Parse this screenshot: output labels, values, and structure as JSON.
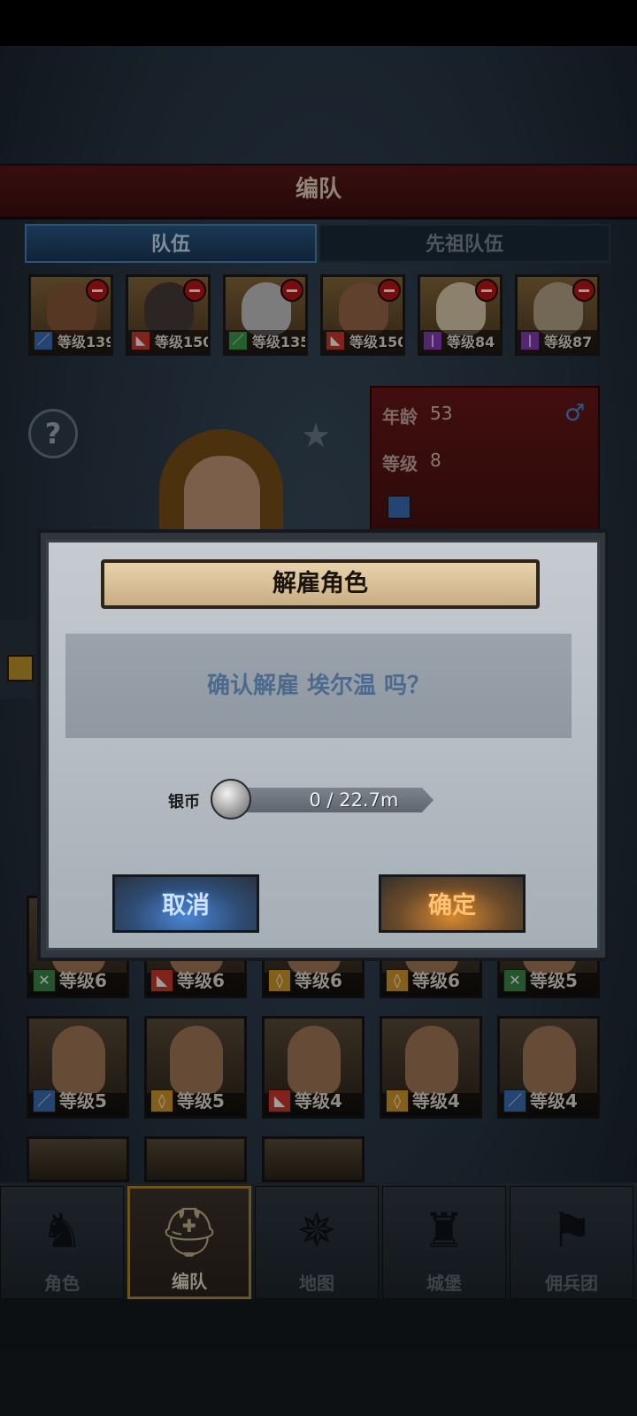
{
  "screen": {
    "header_title": "编队",
    "tabs": [
      {
        "label": "队伍",
        "active": true
      },
      {
        "label": "先祖队伍",
        "active": false
      }
    ]
  },
  "team": [
    {
      "level": "等级139",
      "class_icon": "sword-icon",
      "class_color": "#3b6fb8",
      "portrait_color": "#8a5a3a"
    },
    {
      "level": "等级150",
      "class_icon": "wolf-icon",
      "class_color": "#d0392b",
      "portrait_color": "#4a3a3a"
    },
    {
      "level": "等级135",
      "class_icon": "dagger-icon",
      "class_color": "#3a9a4a",
      "portrait_color": "#c8c8c8"
    },
    {
      "level": "等级150",
      "class_icon": "wolf-icon",
      "class_color": "#d0392b",
      "portrait_color": "#9a6a4a"
    },
    {
      "level": "等级84",
      "class_icon": "staff-icon",
      "class_color": "#8a3ab8",
      "portrait_color": "#e0d0b0"
    },
    {
      "level": "等级87",
      "class_icon": "staff-icon",
      "class_color": "#8a3ab8",
      "portrait_color": "#b8a88a"
    }
  ],
  "hero_info": {
    "age_label": "年龄",
    "age_value": "53",
    "level_label": "等级",
    "level_value": "8",
    "gender_icon": "male-icon"
  },
  "roster": [
    {
      "level": "等级6",
      "class_icon": "crossed-swords-icon",
      "class_color": "#3a8a4a"
    },
    {
      "level": "等级6",
      "class_icon": "wolf-icon",
      "class_color": "#d0392b"
    },
    {
      "level": "等级6",
      "class_icon": "shield-icon",
      "class_color": "#d69a2a"
    },
    {
      "level": "等级6",
      "class_icon": "shield-icon",
      "class_color": "#d69a2a"
    },
    {
      "level": "等级5",
      "class_icon": "crossed-swords-icon",
      "class_color": "#3a8a4a"
    },
    {
      "level": "等级5",
      "class_icon": "sword-icon",
      "class_color": "#3b6fb8"
    },
    {
      "level": "等级5",
      "class_icon": "shield-icon",
      "class_color": "#d69a2a"
    },
    {
      "level": "等级4",
      "class_icon": "wolf-icon",
      "class_color": "#d0392b"
    },
    {
      "level": "等级4",
      "class_icon": "shield-icon",
      "class_color": "#d69a2a"
    },
    {
      "level": "等级4",
      "class_icon": "sword-icon",
      "class_color": "#3b6fb8"
    }
  ],
  "dialog": {
    "title": "解雇角色",
    "message": "确认解雇 埃尔温 吗？",
    "currency_label": "银币",
    "currency_icon": "silver-coin-icon",
    "currency_progress": "0 / 22.7m",
    "cancel_label": "取消",
    "confirm_label": "确定"
  },
  "nav": [
    {
      "label": "角色",
      "icon": "knight-icon",
      "active": false
    },
    {
      "label": "编队",
      "icon": "helmet-icon",
      "active": true
    },
    {
      "label": "地图",
      "icon": "compass-icon",
      "active": false
    },
    {
      "label": "城堡",
      "icon": "castle-icon",
      "active": false
    },
    {
      "label": "佣兵团",
      "icon": "banner-icon",
      "active": false
    }
  ]
}
